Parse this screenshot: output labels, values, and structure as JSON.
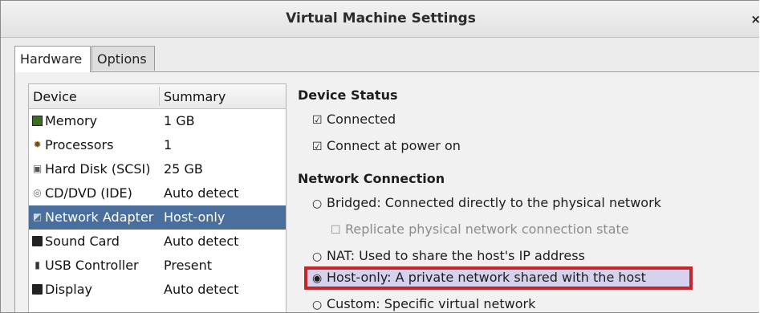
{
  "window": {
    "title": "Virtual Machine Settings",
    "close_glyph": "×"
  },
  "tabs": [
    {
      "label": "Hardware",
      "active": true
    },
    {
      "label": "Options",
      "active": false
    }
  ],
  "device_list": {
    "columns": {
      "device": "Device",
      "summary": "Summary"
    },
    "rows": [
      {
        "icon": "memory-icon",
        "name": "Memory",
        "summary": "1 GB",
        "selected": false
      },
      {
        "icon": "processor-icon",
        "name": "Processors",
        "summary": "1",
        "selected": false
      },
      {
        "icon": "hard-disk-icon",
        "name": "Hard Disk (SCSI)",
        "summary": "25 GB",
        "selected": false
      },
      {
        "icon": "cd-dvd-icon",
        "name": "CD/DVD (IDE)",
        "summary": "Auto detect",
        "selected": false
      },
      {
        "icon": "network-adapter-icon",
        "name": "Network Adapter",
        "summary": "Host-only",
        "selected": true
      },
      {
        "icon": "sound-card-icon",
        "name": "Sound Card",
        "summary": "Auto detect",
        "selected": false
      },
      {
        "icon": "usb-controller-icon",
        "name": "USB Controller",
        "summary": "Present",
        "selected": false
      },
      {
        "icon": "display-icon",
        "name": "Display",
        "summary": "Auto detect",
        "selected": false
      }
    ]
  },
  "device_status": {
    "title": "Device Status",
    "connected": {
      "label": "Connected",
      "checked": true
    },
    "connect_at_power_on": {
      "label": "Connect at power on",
      "checked": true
    }
  },
  "network_connection": {
    "title": "Network Connection",
    "bridged": {
      "label": "Bridged: Connected directly to the physical network",
      "selected": false
    },
    "replicate": {
      "label": "Replicate physical network connection state",
      "checked": false,
      "enabled": false
    },
    "nat": {
      "label": "NAT: Used to share the host's IP address",
      "selected": false
    },
    "host_only": {
      "label": "Host-only: A private network shared with the host",
      "selected": true
    },
    "custom": {
      "label": "Custom: Specific virtual network",
      "selected": false
    }
  },
  "colors": {
    "selection_row": "#4a6f9c",
    "highlight_fill": "#d6d1ec",
    "highlight_border": "#c4262a"
  }
}
